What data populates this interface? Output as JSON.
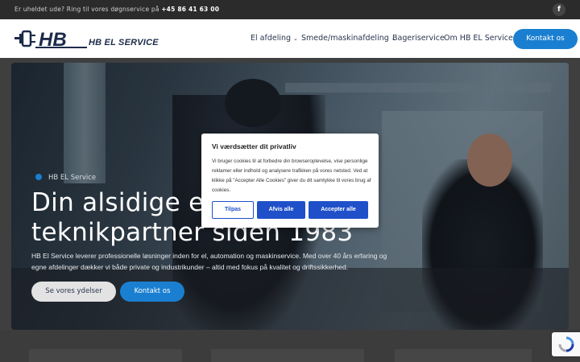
{
  "topbar": {
    "notice_prefix": "Er uheldet ude? Ring til vores døgnservice på ",
    "phone": "+45 86 41 63 00",
    "social_icon": "f"
  },
  "logo": {
    "text": "HB EL SERVICE"
  },
  "nav": {
    "items": [
      {
        "label": "El afdeling",
        "has_dropdown": true
      },
      {
        "label": "Smede/maskinafdeling",
        "has_dropdown": true
      },
      {
        "label": "Bageriservice",
        "has_dropdown": false
      },
      {
        "label": "Om HB EL Service",
        "has_dropdown": true
      }
    ],
    "chevron": "⌄",
    "contact_label": "Kontakt os"
  },
  "hero": {
    "eyebrow": "HB EL Service",
    "headline_line1": "Din alsidige el og",
    "headline_line2": "teknikpartner siden 1983",
    "lead": "HB El Service leverer professionelle løsninger inden for el, automation og maskinservice. Med over 40 års erfaring og egne afdelinger dækker vi både private og industrikunder – altid med fokus på kvalitet og driftssikkerhed.",
    "button_services": "Se vores ydelser",
    "button_contact": "Kontakt os"
  },
  "cookie": {
    "title": "Vi værdsætter dit privatliv",
    "body": "Vi bruger cookies til at forbedre din browseroplevelse, vise personlige reklamer eller indhold og analysere trafikken på vores netsted. Ved at klikke på \"Accepter Alle Cookies\" giver du dit samtykke til vores brug af cookies.",
    "btn_customize": "Tilpas",
    "btn_reject": "Afvis alle",
    "btn_accept": "Accepter alle"
  },
  "colors": {
    "accent": "#1a7fd0",
    "cookie_button": "#1f50c9",
    "topbar": "#2b2b2b",
    "nav_text": "#2a3550"
  }
}
